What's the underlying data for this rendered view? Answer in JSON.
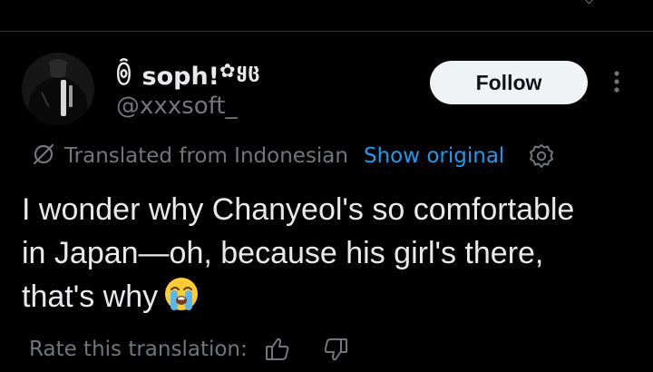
{
  "tweet": {
    "author": {
      "display_name": "ꉺ soph!",
      "name_decoration": "✿ყც",
      "handle": "@xxxsoft_"
    },
    "follow_label": "Follow",
    "translation": {
      "label": "Translated from Indonesian",
      "show_original_label": "Show original"
    },
    "text_lines": [
      "I wonder why Chanyeol's so comfortable",
      "in Japan—oh, because his girl's there,",
      "that's why"
    ],
    "text_emoji": "loudly-crying-face-emoji",
    "rate": {
      "label": "Rate this translation:",
      "up_icon": "thumbs-up-icon",
      "down_icon": "thumbs-down-icon"
    }
  },
  "colors": {
    "background": "#000000",
    "text_primary": "#e7e9ea",
    "text_secondary": "#71767b",
    "link_blue": "#1d9bf0",
    "follow_button_bg": "#eff3f4"
  }
}
